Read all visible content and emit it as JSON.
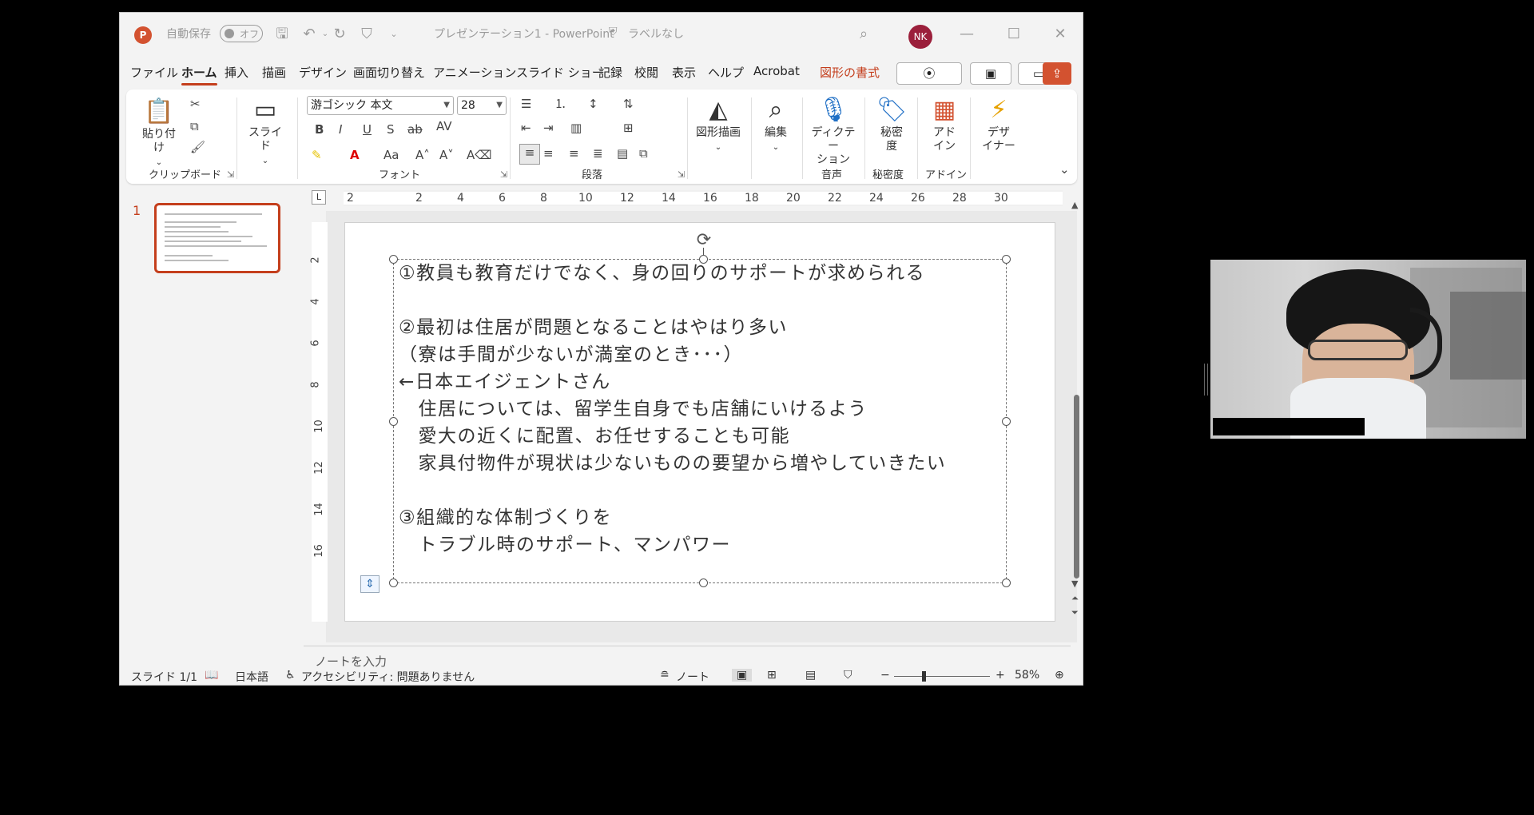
{
  "titlebar": {
    "app_logo": "P",
    "autosave_label": "自動保存",
    "autosave_state": "オフ",
    "title": "プレゼンテーション1 - PowerPoint",
    "sensitivity": "ラベルなし",
    "user_initials": "NK"
  },
  "tabs": [
    "ファイル",
    "ホーム",
    "挿入",
    "描画",
    "デザイン",
    "画面切り替え",
    "アニメーション",
    "スライド ショー",
    "記録",
    "校閲",
    "表示",
    "ヘルプ",
    "Acrobat",
    "図形の書式"
  ],
  "ribbon": {
    "clipboard": {
      "paste": "貼り付け",
      "label": "クリップボード"
    },
    "slides": {
      "slide": "スライド"
    },
    "font": {
      "name": "游ゴシック 本文",
      "size": "28",
      "label": "フォント"
    },
    "paragraph": {
      "label": "段落"
    },
    "drawing": {
      "shapes": "図形描画"
    },
    "editing": {
      "label": "編集"
    },
    "voice": {
      "dictate1": "ディクテー",
      "dictate2": "ション",
      "label": "音声"
    },
    "sensitivity": {
      "name1": "秘密",
      "name2": "度",
      "label": "秘密度"
    },
    "addins": {
      "name1": "アド",
      "name2": "イン",
      "label": "アドイン"
    },
    "designer": {
      "name1": "デザ",
      "name2": "イナー"
    }
  },
  "thumbnail": {
    "number": "1"
  },
  "ruler": {
    "h_ticks": [
      "2",
      "2",
      "4",
      "6",
      "8",
      "10",
      "12",
      "14",
      "16",
      "18",
      "20",
      "22",
      "24",
      "26",
      "28",
      "30"
    ],
    "v_ticks": [
      "2",
      "4",
      "6",
      "8",
      "10",
      "12",
      "14",
      "16"
    ]
  },
  "slide": {
    "lines": [
      "①教員も教育だけでなく、身の回りのサポートが求められる",
      "",
      "②最初は住居が問題となることはやはり多い",
      "（寮は手間が少ないが満室のとき･･･）",
      "←日本エイジェントさん",
      "　住居については、留学生自身でも店舗にいけるよう",
      "　愛大の近くに配置、お任せすることも可能",
      "　家具付物件が現状は少ないものの要望から増やしていきたい",
      "",
      "③組織的な体制づくりを",
      "　トラブル時のサポート、マンパワー"
    ]
  },
  "notes": {
    "placeholder": "ノートを入力"
  },
  "status": {
    "slide": "スライド 1/1",
    "language": "日本語",
    "accessibility": "アクセシビリティ: 問題ありません",
    "notes": "ノート",
    "zoom": "58%"
  }
}
